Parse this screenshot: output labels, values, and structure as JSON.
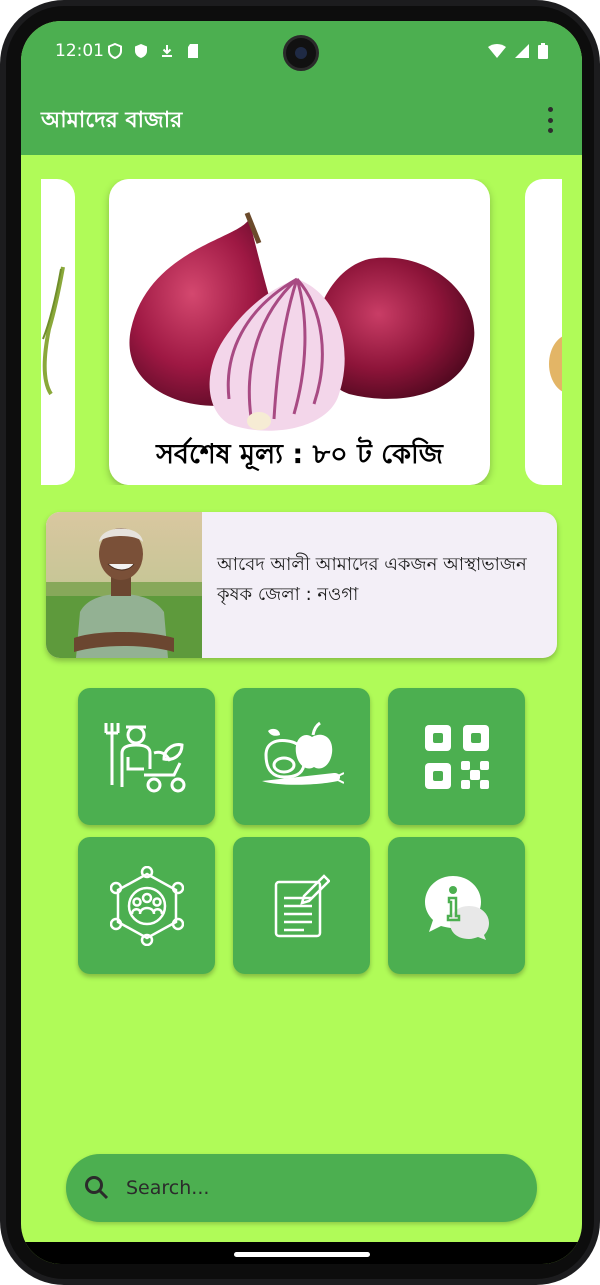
{
  "status_bar": {
    "time": "12:01"
  },
  "app": {
    "title": "আমাদের বাজার"
  },
  "carousel": {
    "price_text": "সর্বশেষ মূল্য : ৮০ ট কেজি"
  },
  "farmer": {
    "description": "আবেদ আলী আমাদের একজন আস্থাভাজন কৃষক জেলা : নওগা"
  },
  "grid": {
    "tiles": [
      {
        "icon": "farmer-icon"
      },
      {
        "icon": "vegetables-icon"
      },
      {
        "icon": "qr-code-icon"
      },
      {
        "icon": "community-network-icon"
      },
      {
        "icon": "notes-icon"
      },
      {
        "icon": "info-chat-icon"
      }
    ]
  },
  "search": {
    "placeholder": "Search..."
  },
  "colors": {
    "primary": "#4caf50",
    "background": "#b0fb58"
  }
}
